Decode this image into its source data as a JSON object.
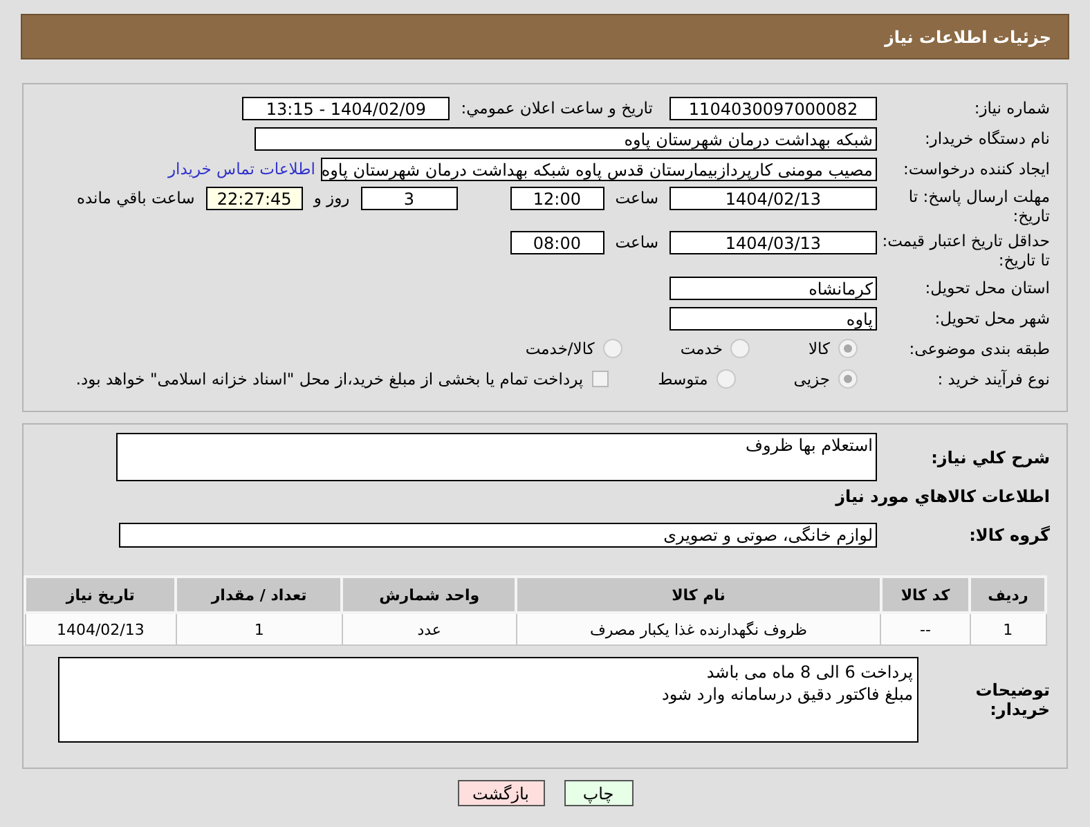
{
  "header": {
    "title": "جزئیات اطلاعات نیاز"
  },
  "info": {
    "need_number": {
      "label": "شماره نیاز:",
      "value": "1104030097000082"
    },
    "announce": {
      "label": "تاریخ و ساعت اعلان عمومي:",
      "value": "1404/02/09 - 13:15"
    },
    "buyer": {
      "label": "نام دستگاه خریدار:",
      "value": "شبکه بهداشت درمان شهرستان پاوه"
    },
    "creator": {
      "label": "ایجاد کننده درخواست:",
      "value": "مصیب مومنی کارپردازبیمارستان قدس پاوه شبکه بهداشت درمان شهرستان پاوه",
      "link": "اطلاعات تماس خریدار"
    },
    "deadline": {
      "label": "مهلت ارسال پاسخ: تا تاریخ:",
      "date": "1404/02/13",
      "time_label": "ساعت",
      "time": "12:00",
      "days": "3",
      "days_label": "روز و",
      "remaining": "22:27:45",
      "remaining_label": "ساعت باقي مانده"
    },
    "validity": {
      "label": "حداقل تاریخ اعتبار قیمت: تا تاریخ:",
      "date": "1404/03/13",
      "time_label": "ساعت",
      "time": "08:00"
    },
    "province": {
      "label": "استان محل تحویل:",
      "value": "کرمانشاه"
    },
    "city": {
      "label": "شهر محل تحویل:",
      "value": "پاوه"
    },
    "category": {
      "label": "طبقه بندی موضوعی:",
      "options": [
        {
          "label": "کالا",
          "selected": true
        },
        {
          "label": "خدمت",
          "selected": false
        },
        {
          "label": "کالا/خدمت",
          "selected": false
        }
      ]
    },
    "process": {
      "label": "نوع فرآیند خرید :",
      "options": [
        {
          "label": "جزیی",
          "selected": true
        },
        {
          "label": "متوسط",
          "selected": false
        }
      ],
      "treasury": {
        "label": "پرداخت تمام یا بخشی از مبلغ خرید،از محل \"اسناد خزانه اسلامی\" خواهد بود.",
        "checked": false
      }
    }
  },
  "details": {
    "description": {
      "label": "شرح کلي نیاز:",
      "value": "استعلام بها ظروف"
    },
    "goods_heading": "اطلاعات کالاهاي مورد نیاز",
    "group": {
      "label": "گروه کالا:",
      "value": "لوازم خانگی، صوتی و تصویری"
    },
    "table": {
      "columns": [
        "ردیف",
        "کد کالا",
        "نام کالا",
        "واحد شمارش",
        "تعداد / مقدار",
        "تاریخ نیاز"
      ],
      "rows": [
        [
          "1",
          "--",
          "ظروف نگهدارنده غذا یکبار مصرف",
          "عدد",
          "1",
          "1404/02/13"
        ]
      ]
    },
    "notes": {
      "label": "توضیحات خریدار:",
      "lines": [
        "پرداخت 6 الی 8 ماه می باشد",
        "مبلغ فاکتور دقیق درسامانه وارد شود"
      ]
    }
  },
  "buttons": [
    {
      "label": "چاپ",
      "kind": "print"
    },
    {
      "label": "بازگشت",
      "kind": "back"
    }
  ]
}
